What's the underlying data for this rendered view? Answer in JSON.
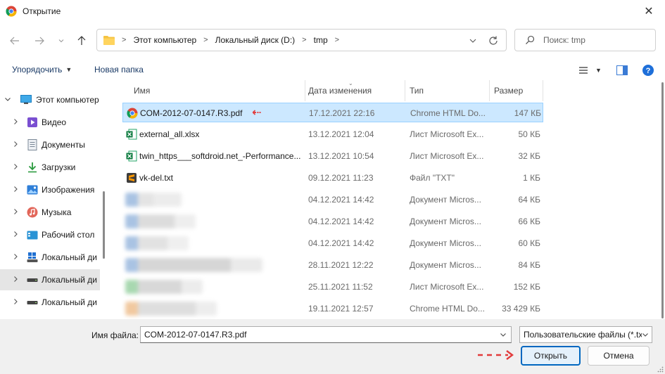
{
  "window": {
    "title": "Открытие",
    "close_glyph": "✕"
  },
  "navigation": {
    "back_icon": "arrow-left-icon",
    "forward_icon": "arrow-right-icon",
    "recent_icon": "chevron-down-icon",
    "up_icon": "arrow-up-icon",
    "breadcrumb": [
      "Этот компьютер",
      "Локальный диск (D:)",
      "tmp"
    ],
    "search_placeholder": "Поиск: tmp"
  },
  "toolbar": {
    "organize_label": "Упорядочить",
    "new_folder_label": "Новая папка",
    "help_glyph": "?"
  },
  "sidebar": {
    "items": [
      {
        "label": "Этот компьютер",
        "icon": "monitor-icon",
        "expander": "v"
      },
      {
        "label": "Видео",
        "icon": "video-icon",
        "expander": ">"
      },
      {
        "label": "Документы",
        "icon": "documents-icon",
        "expander": ">"
      },
      {
        "label": "Загрузки",
        "icon": "download-icon",
        "expander": ">"
      },
      {
        "label": "Изображения",
        "icon": "pictures-icon",
        "expander": ">"
      },
      {
        "label": "Музыка",
        "icon": "music-icon",
        "expander": ">"
      },
      {
        "label": "Рабочий стол",
        "icon": "desktop-icon",
        "expander": ">"
      },
      {
        "label": "Локальный ди",
        "icon": "windows-drive-icon",
        "expander": ">"
      },
      {
        "label": "Локальный ди",
        "icon": "drive-icon",
        "expander": ">"
      },
      {
        "label": "Локальный ди",
        "icon": "drive-icon",
        "expander": ">"
      }
    ]
  },
  "columns": {
    "name": "Имя",
    "date": "Дата изменения",
    "type": "Тип",
    "size": "Размер"
  },
  "files": [
    {
      "name": "COM-2012-07-0147.R3.pdf",
      "date": "17.12.2021 22:16",
      "type": "Chrome HTML Do...",
      "size": "147 КБ",
      "icon": "chrome-icon"
    },
    {
      "name": "external_all.xlsx",
      "date": "13.12.2021 12:04",
      "type": "Лист Microsoft Ex...",
      "size": "50 КБ",
      "icon": "excel-icon"
    },
    {
      "name": "twin_https___softdroid.net_-Performance...",
      "date": "13.12.2021 10:54",
      "type": "Лист Microsoft Ex...",
      "size": "32 КБ",
      "icon": "excel-icon"
    },
    {
      "name": "vk-del.txt",
      "date": "09.12.2021 11:23",
      "type": "Файл \"TXT\"",
      "size": "1 КБ",
      "icon": "sublime-icon"
    },
    {
      "name": "",
      "date": "04.12.2021 14:42",
      "type": "Документ Micros...",
      "size": "64 КБ",
      "icon": "blurred-icon"
    },
    {
      "name": "",
      "date": "04.12.2021 14:42",
      "type": "Документ Micros...",
      "size": "66 КБ",
      "icon": "blurred-icon"
    },
    {
      "name": "",
      "date": "04.12.2021 14:42",
      "type": "Документ Micros...",
      "size": "60 КБ",
      "icon": "blurred-icon"
    },
    {
      "name": "",
      "date": "28.11.2021 12:22",
      "type": "Документ Micros...",
      "size": "84 КБ",
      "icon": "blurred-icon"
    },
    {
      "name": "",
      "date": "25.11.2021 11:52",
      "type": "Лист Microsoft Ex...",
      "size": "152 КБ",
      "icon": "blurred-icon"
    },
    {
      "name": "",
      "date": "19.11.2021 12:57",
      "type": "Chrome HTML Do...",
      "size": "33 429 КБ",
      "icon": "blurred-icon"
    }
  ],
  "footer": {
    "filename_label": "Имя файла:",
    "filename_value": "COM-2012-07-0147.R3.pdf",
    "filter_value": "Пользовательские файлы (*.txt",
    "open_label": "Открыть",
    "cancel_label": "Отмена"
  },
  "annotations": {
    "arrow_color": "#e23b3b",
    "row_arrow_glyph": "⇠"
  },
  "colors": {
    "selection_bg": "#cce8ff",
    "selection_border": "#99d1ff",
    "primary_button_border": "#0067c0",
    "link_text": "#1a3a66"
  }
}
